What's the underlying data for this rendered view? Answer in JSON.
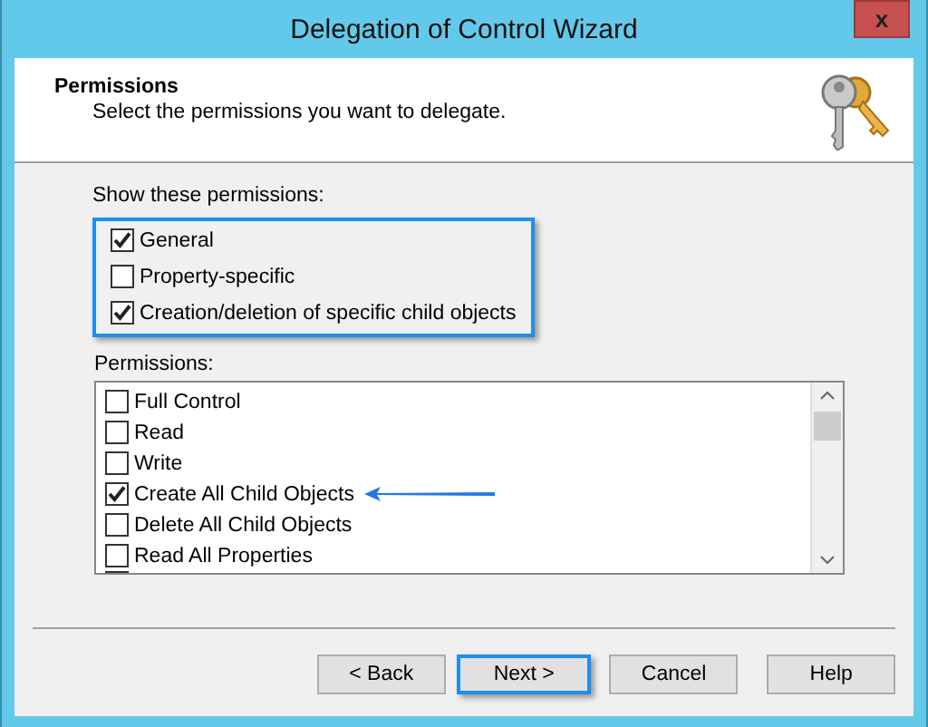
{
  "window": {
    "title": "Delegation of Control Wizard",
    "close_label": "x"
  },
  "header": {
    "title": "Permissions",
    "subtitle": "Select the permissions you want to delegate."
  },
  "show_group": {
    "label": "Show these permissions:",
    "highlighted": true,
    "options": [
      {
        "label": "General",
        "checked": true
      },
      {
        "label": "Property-specific",
        "checked": false
      },
      {
        "label": "Creation/deletion of specific child objects",
        "checked": true
      }
    ]
  },
  "permissions": {
    "label": "Permissions:",
    "items": [
      {
        "label": "Full Control",
        "checked": false,
        "arrow": false
      },
      {
        "label": "Read",
        "checked": false,
        "arrow": false
      },
      {
        "label": "Write",
        "checked": false,
        "arrow": false
      },
      {
        "label": "Create All Child Objects",
        "checked": true,
        "arrow": true
      },
      {
        "label": "Delete All Child Objects",
        "checked": false,
        "arrow": false
      },
      {
        "label": "Read All Properties",
        "checked": false,
        "arrow": false
      }
    ]
  },
  "buttons": [
    {
      "label": "< Back",
      "highlighted": false
    },
    {
      "label": "Next >",
      "highlighted": true
    },
    {
      "label": "Cancel",
      "highlighted": false
    },
    {
      "label": "Help",
      "highlighted": false
    }
  ]
}
